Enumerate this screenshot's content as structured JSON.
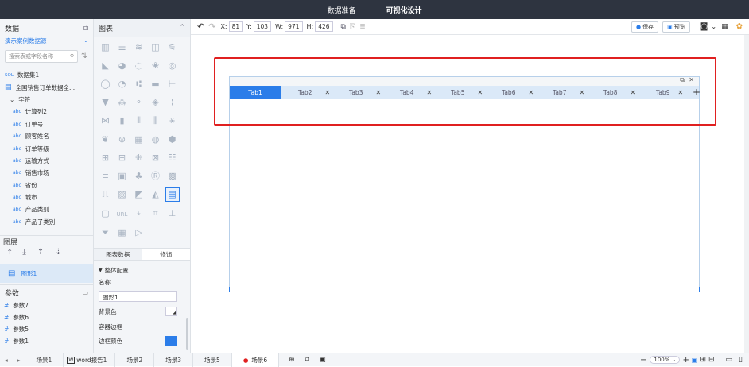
{
  "topbar": {
    "tab1": "数据准备",
    "tab2": "可视化设计"
  },
  "left": {
    "title": "数据",
    "datasource": "演示案例数据源",
    "search_placeholder": "搜索表或字段名称",
    "tree": [
      "数据集1",
      "全国销售订单数据全...",
      "字符",
      "计算列2",
      "订单号",
      "顾客姓名",
      "订单等级",
      "运输方式",
      "销售市场",
      "省份",
      "城市",
      "产品类别",
      "产品子类别"
    ],
    "layer_title": "图层",
    "layer_item": "图形1",
    "param_title": "参数",
    "params": [
      "参数7",
      "参数6",
      "参数5",
      "参数1"
    ]
  },
  "mid": {
    "title": "图表",
    "tab_data": "图表数据",
    "tab_style": "修饰",
    "section": "整体配置",
    "name_label": "名称",
    "name_value": "图形1",
    "bg_label": "背景色",
    "border_label": "容器边框",
    "border_color_label": "边框颜色"
  },
  "toolbar": {
    "x_label": "X:",
    "x": "81",
    "y_label": "Y:",
    "y": "103",
    "w_label": "W:",
    "w": "971",
    "h_label": "H:",
    "h": "426",
    "save": "保存",
    "preview": "预览"
  },
  "canvas": {
    "tabs": [
      "Tab1",
      "Tab2",
      "Tab3",
      "Tab4",
      "Tab5",
      "Tab6",
      "Tab7",
      "Tab8",
      "Tab9"
    ],
    "highlight_color": "#e02020"
  },
  "bottom": {
    "scenes": [
      "场景1",
      "word报告1",
      "场景2",
      "场景3",
      "场景5",
      "场景6"
    ],
    "zoom": "100%"
  }
}
